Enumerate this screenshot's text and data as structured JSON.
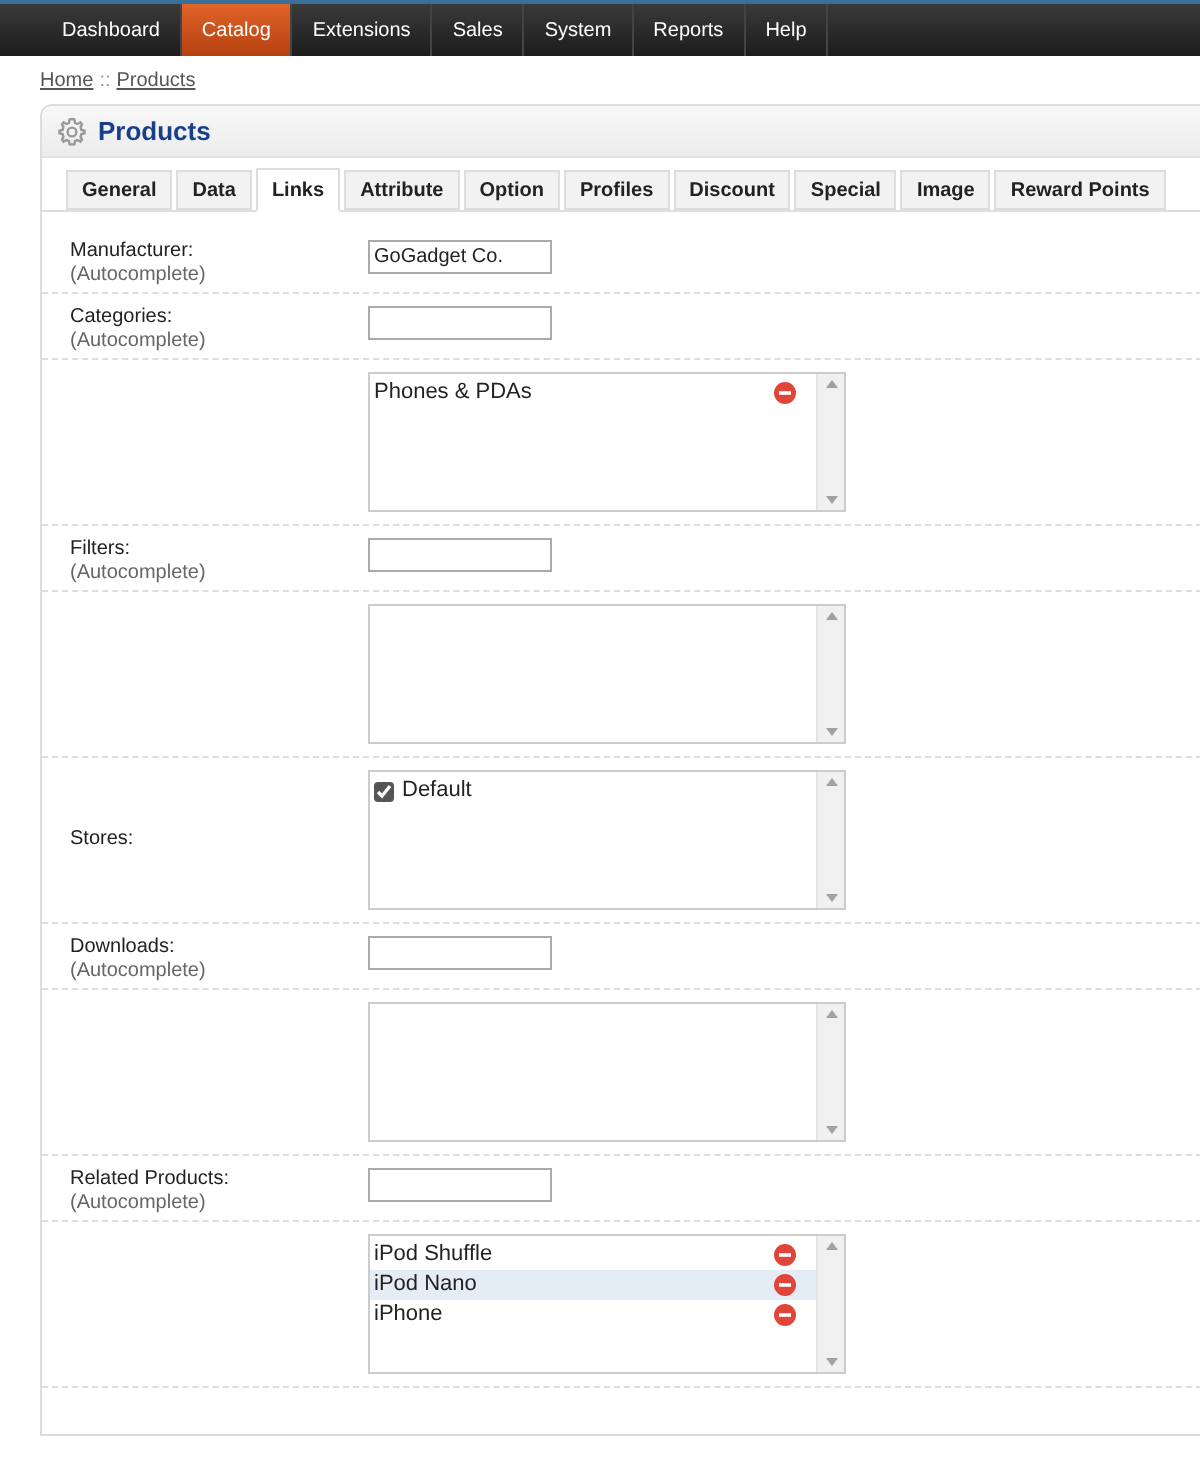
{
  "nav": [
    {
      "label": "Dashboard",
      "selected": false
    },
    {
      "label": "Catalog",
      "selected": true
    },
    {
      "label": "Extensions",
      "selected": false
    },
    {
      "label": "Sales",
      "selected": false
    },
    {
      "label": "System",
      "selected": false
    },
    {
      "label": "Reports",
      "selected": false
    },
    {
      "label": "Help",
      "selected": false
    }
  ],
  "breadcrumb": {
    "links": [
      "Home",
      "Products"
    ],
    "separator": "::"
  },
  "panel": {
    "title": "Products"
  },
  "tabs": [
    {
      "label": "General",
      "selected": false
    },
    {
      "label": "Data",
      "selected": false
    },
    {
      "label": "Links",
      "selected": true
    },
    {
      "label": "Attribute",
      "selected": false
    },
    {
      "label": "Option",
      "selected": false
    },
    {
      "label": "Profiles",
      "selected": false
    },
    {
      "label": "Discount",
      "selected": false
    },
    {
      "label": "Special",
      "selected": false
    },
    {
      "label": "Image",
      "selected": false
    },
    {
      "label": "Reward Points",
      "selected": false
    }
  ],
  "form": [
    {
      "kind": "input",
      "label": "Manufacturer:",
      "hint": "(Autocomplete)",
      "value": "GoGadget Co."
    },
    {
      "kind": "input",
      "label": "Categories:",
      "hint": "(Autocomplete)"
    },
    {
      "kind": "list",
      "items": [
        {
          "label": "Phones & PDAs",
          "selected": false
        }
      ]
    },
    {
      "kind": "input",
      "label": "Filters:",
      "hint": "(Autocomplete)"
    },
    {
      "kind": "list"
    },
    {
      "kind": "checklist",
      "label": "Stores:",
      "items": [
        {
          "label": "Default",
          "checked": true
        }
      ]
    },
    {
      "kind": "input",
      "label": "Downloads:",
      "hint": "(Autocomplete)"
    },
    {
      "kind": "list"
    },
    {
      "kind": "input",
      "label": "Related Products:",
      "hint": "(Autocomplete)"
    },
    {
      "kind": "list",
      "items": [
        {
          "label": "iPod Shuffle",
          "selected": false
        },
        {
          "label": "iPod Nano",
          "selected": true
        },
        {
          "label": "iPhone",
          "selected": false
        }
      ]
    }
  ]
}
